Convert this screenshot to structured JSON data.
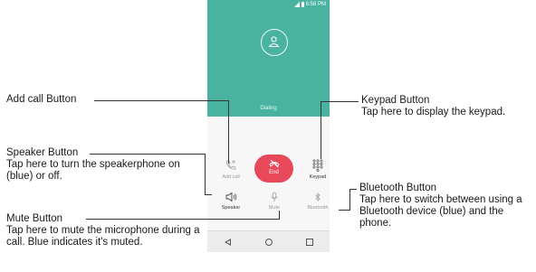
{
  "status_bar": {
    "time": "6:58 PM"
  },
  "call_screen": {
    "status_text": "Dialing",
    "add_call_label": "Add call",
    "end_label": "End",
    "keypad_label": "Keypad",
    "speaker_label": "Speaker",
    "mute_label": "Mute",
    "bluetooth_label": "Bluetooth"
  },
  "callouts": {
    "add_call": {
      "title": "Add call Button"
    },
    "keypad": {
      "title": "Keypad Button",
      "description": "Tap here to display the keypad."
    },
    "speaker": {
      "title": "Speaker Button",
      "description": "Tap here to turn the speakerphone on (blue) or off."
    },
    "bluetooth": {
      "title": "Bluetooth Button",
      "description": "Tap here to switch between using a Bluetooth device (blue) and the phone."
    },
    "mute": {
      "title": "Mute Button",
      "description": "Tap here to mute the microphone during a call. Blue indicates it's muted."
    }
  },
  "icons": {
    "avatar": "contact-avatar-icon",
    "add_call": "phone-plus-icon",
    "end": "hangup-icon",
    "keypad": "dialpad-icon",
    "speaker": "speaker-icon",
    "mute": "mic-icon",
    "bluetooth": "bluetooth-icon",
    "back": "back-icon",
    "home": "home-icon",
    "recents": "recents-icon"
  },
  "colors": {
    "header_teal": "#49b3a0",
    "end_red": "#e8495a"
  }
}
